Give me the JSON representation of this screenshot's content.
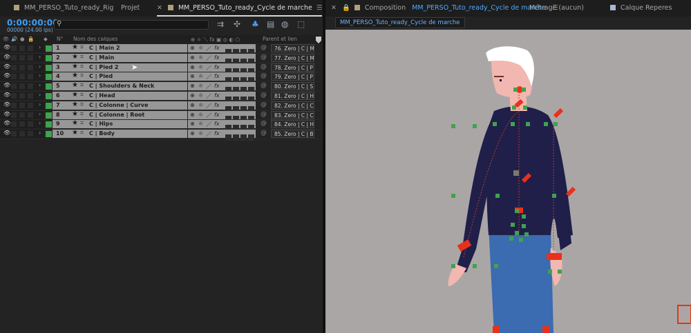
{
  "left_tabs": [
    {
      "label": "MM_PERSO_Tuto_ready_Rig"
    },
    {
      "label": "Projet"
    },
    {
      "label": "MM_PERSO_Tuto_ready_Cycle de marche"
    }
  ],
  "timecode": "0:00:00:00",
  "frame_info": "00000 (24.00 ips)",
  "columns": {
    "num": "N°",
    "name": "Nom des calques",
    "parent": "Parent et lien"
  },
  "layers": [
    {
      "num": "1",
      "name": "C | Main 2",
      "parent": "76. Zero | C | M"
    },
    {
      "num": "2",
      "name": "C | Main",
      "parent": "77. Zero | C | M"
    },
    {
      "num": "3",
      "name": "C | Pied 2",
      "parent": "78. Zero | C | P"
    },
    {
      "num": "4",
      "name": "C | Pied",
      "parent": "79. Zero | C | P"
    },
    {
      "num": "5",
      "name": "C | Shoulders & Neck",
      "parent": "80. Zero | C | S"
    },
    {
      "num": "6",
      "name": "C | Head",
      "parent": "81. Zero | C | H"
    },
    {
      "num": "7",
      "name": "C | Colonne | Curve",
      "parent": "82. Zero | C | C"
    },
    {
      "num": "8",
      "name": "C | Colonne | Root",
      "parent": "83. Zero | C | C"
    },
    {
      "num": "9",
      "name": "C | Hips",
      "parent": "84. Zero | C | H"
    },
    {
      "num": "10",
      "name": "C | Body",
      "parent": "85. Zero | C | B"
    }
  ],
  "right_tabs": {
    "composition_prefix": "Composition",
    "composition_name": "MM_PERSO_Tuto_ready_Cycle de marche",
    "metrage": "Métrage (aucun)",
    "calque": "Calque Reperes"
  },
  "comp_subtab": "MM_PERSO_Tuto_ready_Cycle de marche",
  "colors": {
    "timecode": "#3d9df3",
    "label_green": "#3fa34d",
    "viewer_bg": "#aaa6a6",
    "shirt": "#1f1f4a",
    "pants": "#3b6bb0",
    "skin": "#f2b7b0",
    "hair": "#ffffff",
    "controller_red": "#e8311a",
    "controller_green": "#3fa34d"
  }
}
